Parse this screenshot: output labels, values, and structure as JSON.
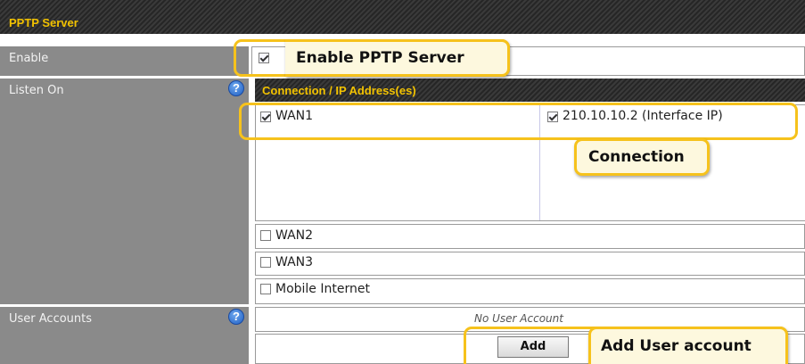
{
  "header": {
    "title": "PPTP Server"
  },
  "labels": {
    "enable": "Enable",
    "listen_on": "Listen On",
    "user_accounts": "User Accounts"
  },
  "help_icon": "?",
  "enable_checkbox": {
    "checked": true
  },
  "connection_table": {
    "header": "Connection / IP Address(es)",
    "rows": [
      {
        "name": "WAN1",
        "checked": true,
        "ip": "210.10.10.2 (Interface IP)",
        "ip_checked": true
      },
      {
        "name": "WAN2",
        "checked": false
      },
      {
        "name": "WAN3",
        "checked": false
      },
      {
        "name": "Mobile Internet",
        "checked": false
      }
    ]
  },
  "user_accounts": {
    "empty_text": "No User Account",
    "add_button": "Add"
  },
  "callouts": {
    "enable": "Enable PPTP Server",
    "connection": "Connection",
    "add_user": "Add User account"
  },
  "colors": {
    "header_text": "#f2c200",
    "label_bg": "#8a8a8a",
    "callout_border": "#f6c21c",
    "help_icon": "#1f5fc4"
  }
}
